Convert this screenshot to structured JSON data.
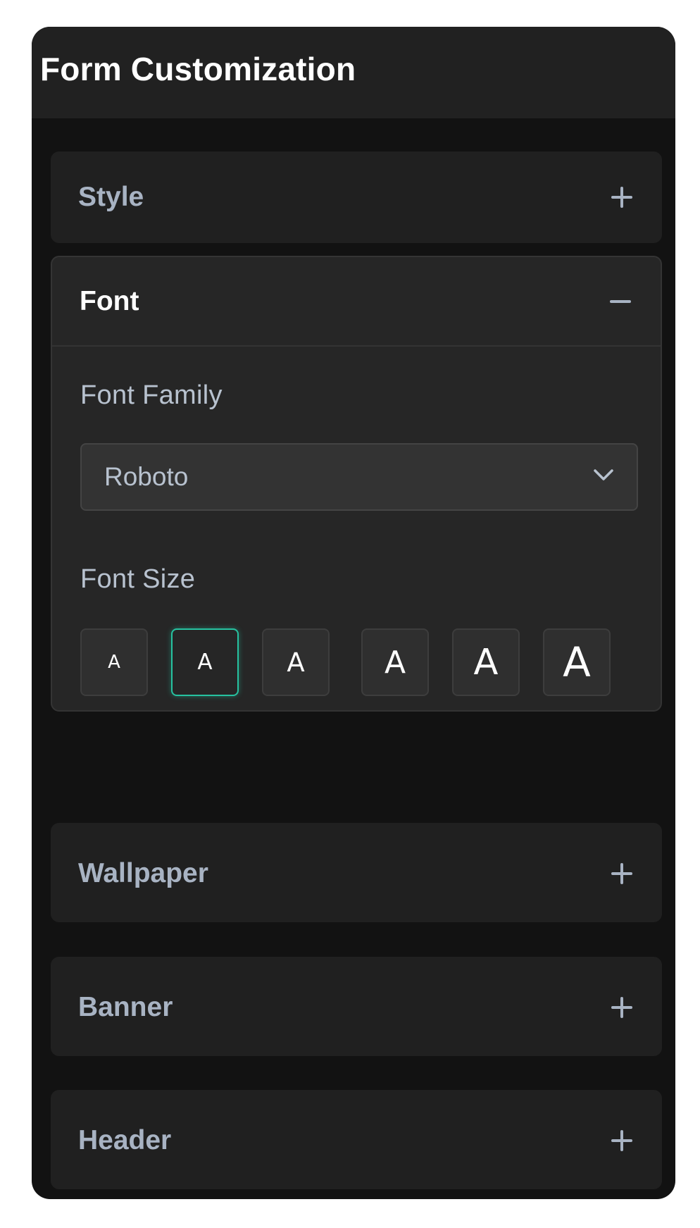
{
  "panel": {
    "title": "Form Customization"
  },
  "sections": {
    "style": {
      "label": "Style",
      "toggle_icon": "plus-icon"
    },
    "font": {
      "label": "Font",
      "toggle_icon": "minus-icon",
      "expanded": true,
      "font_family": {
        "label": "Font Family",
        "value": "Roboto"
      },
      "font_size": {
        "label": "Font Size",
        "options": [
          "A",
          "A",
          "A",
          "A",
          "A",
          "A"
        ],
        "selected_index": 1
      }
    },
    "wallpaper": {
      "label": "Wallpaper",
      "toggle_icon": "plus-icon"
    },
    "banner": {
      "label": "Banner",
      "toggle_icon": "plus-icon"
    },
    "header": {
      "label": "Header",
      "toggle_icon": "plus-icon"
    }
  },
  "colors": {
    "accent": "#26c2a0",
    "panel_bg": "#121212",
    "section_bg": "#202020",
    "muted_text": "#a8b3c3"
  }
}
